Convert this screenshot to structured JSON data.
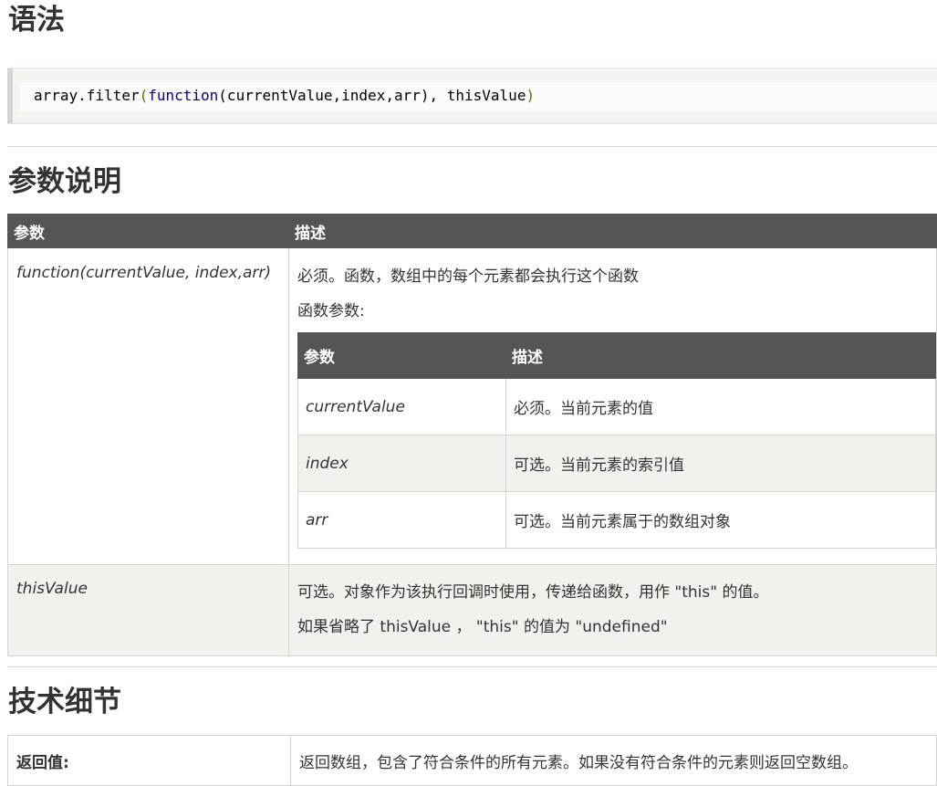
{
  "sections": {
    "syntax_title": "语法",
    "params_title": "参数说明",
    "details_title": "技术细节"
  },
  "code": {
    "prefix": "array.filter",
    "paren_open": "(",
    "keyword": "function",
    "args": "(currentValue,index,arr), thisValue",
    "paren_close": ")"
  },
  "params_table": {
    "headers": [
      "参数",
      "描述"
    ],
    "rows": [
      {
        "name": "function(currentValue, index,arr)",
        "desc_lines": [
          "必须。函数，数组中的每个元素都会执行这个函数",
          "函数参数:"
        ],
        "inner": {
          "headers": [
            "参数",
            "描述"
          ],
          "rows": [
            {
              "name": "currentValue",
              "desc": "必须。当前元素的值"
            },
            {
              "name": "index",
              "desc": "可选。当前元素的索引值"
            },
            {
              "name": "arr",
              "desc": "可选。当前元素属于的数组对象"
            }
          ]
        }
      },
      {
        "name": "thisValue",
        "desc_lines": [
          "可选。对象作为该执行回调时使用，传递给函数，用作 \"this\" 的值。",
          "如果省略了 thisValue ， \"this\" 的值为 \"undefined\""
        ]
      }
    ]
  },
  "details_table": {
    "rows": [
      {
        "label": "返回值:",
        "value": "返回数组，包含了符合条件的所有元素。如果没有符合条件的元素则返回空数组。"
      }
    ]
  }
}
